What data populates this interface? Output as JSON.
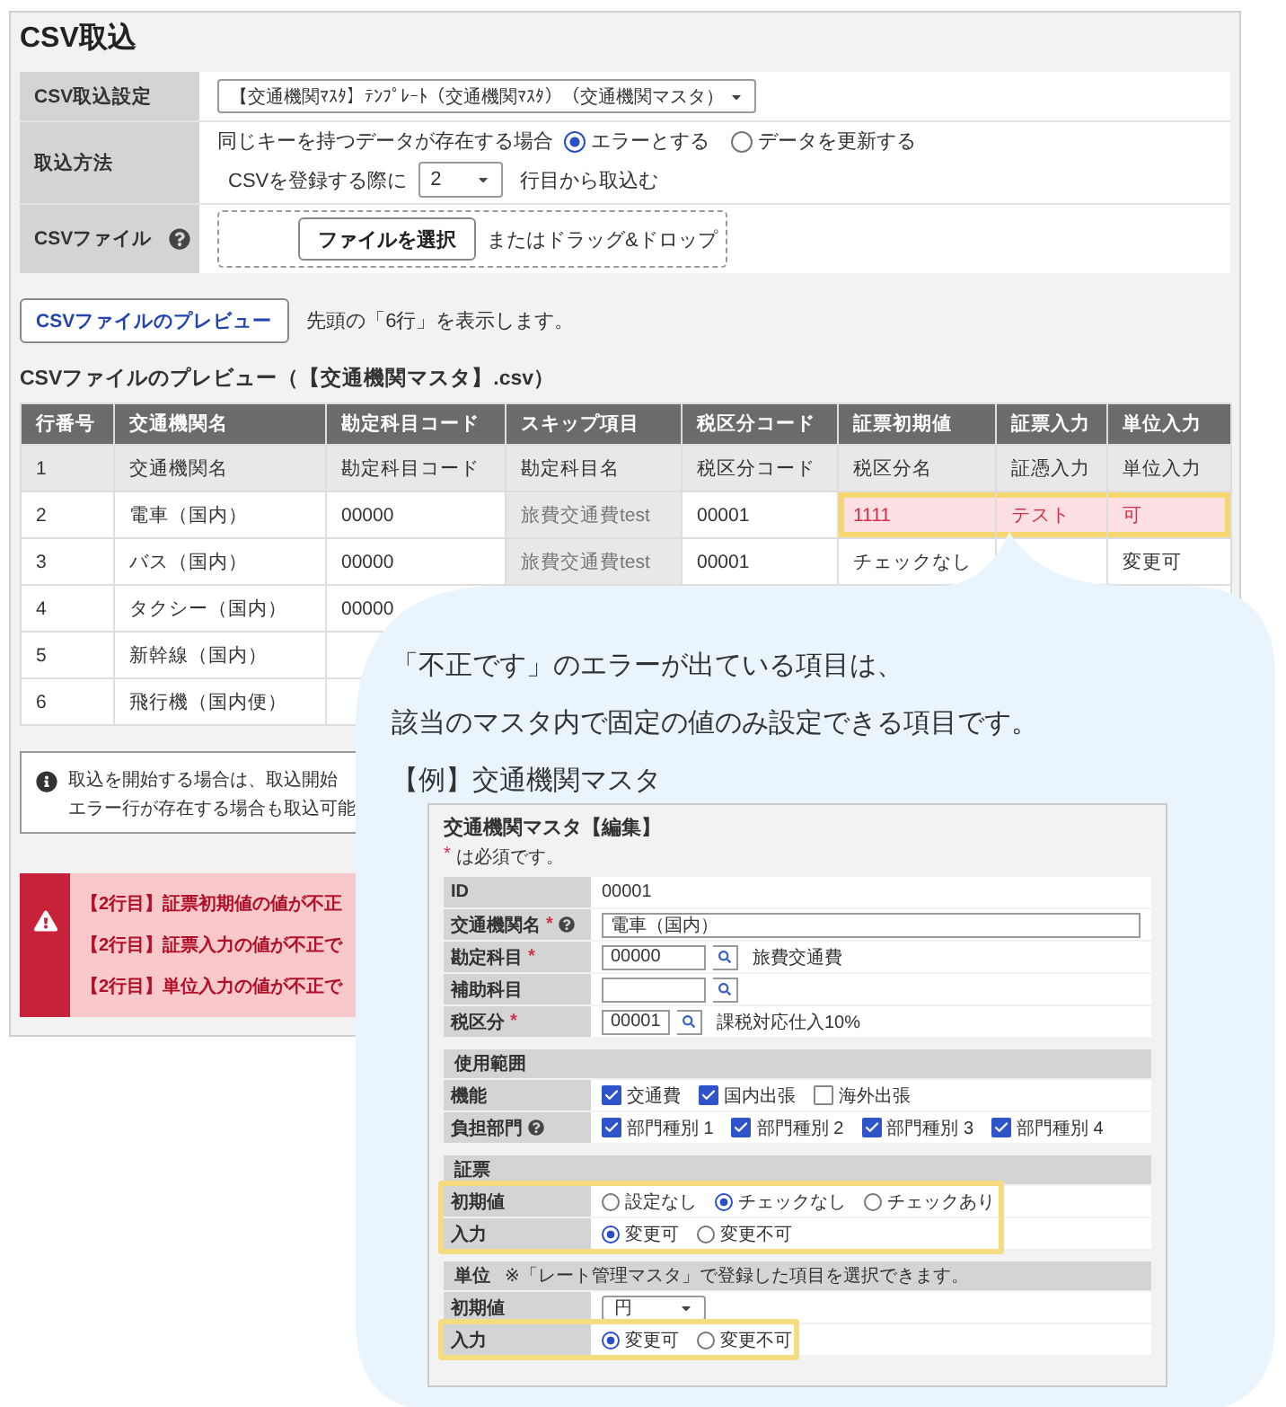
{
  "page_title": "CSV取込",
  "settings": [
    {
      "kind": "select",
      "label": "CSV取込設定",
      "help": false,
      "value": "【交通機関ﾏｽﾀ】ﾃﾝﾌﾟﾚｰﾄ（交通機関ﾏｽﾀ）（交通機関マスタ）"
    },
    {
      "kind": "method",
      "label": "取込方法",
      "help": false,
      "prompt": "同じキーを持つデータが存在する場合",
      "options": [
        {
          "label": "エラーとする",
          "selected": true
        },
        {
          "label": "データを更新する",
          "selected": false
        }
      ],
      "start_prefix": "CSVを登録する際に",
      "start_row": "2",
      "start_suffix": "行目から取込む"
    },
    {
      "kind": "file",
      "label": "CSVファイル",
      "help": true,
      "button": "ファイルを選択",
      "drop_hint": "またはドラッグ&ドロップ"
    }
  ],
  "preview_button": "CSVファイルのプレビュー",
  "preview_note": "先頭の「6行」を表示します。",
  "table": {
    "title": "CSVファイルのプレビュー（【交通機関マスタ】.csv）",
    "columns": [
      {
        "label": "行番号",
        "kind": "field"
      },
      {
        "label": "交通機関名",
        "kind": "field"
      },
      {
        "label": "勘定科目コード",
        "kind": "field"
      },
      {
        "label": "スキップ項目",
        "kind": "skip"
      },
      {
        "label": "税区分コード",
        "kind": "field"
      },
      {
        "label": "証票初期値",
        "kind": "field"
      },
      {
        "label": "証票入力",
        "kind": "field"
      },
      {
        "label": "単位入力",
        "kind": "field"
      }
    ],
    "rows": [
      {
        "kind": "csv_header",
        "cells": [
          {
            "text": "1",
            "error": false
          },
          {
            "text": "交通機関名",
            "error": false
          },
          {
            "text": "勘定科目コード",
            "error": false
          },
          {
            "text": "勘定科目名",
            "error": false
          },
          {
            "text": "税区分コード",
            "error": false
          },
          {
            "text": "税区分名",
            "error": false
          },
          {
            "text": "証憑入力",
            "error": false
          },
          {
            "text": "単位入力",
            "error": false
          }
        ]
      },
      {
        "kind": "data",
        "cells": [
          {
            "text": "2",
            "error": false
          },
          {
            "text": "電車（国内）",
            "error": false
          },
          {
            "text": "00000",
            "error": false
          },
          {
            "text": "旅費交通費test",
            "error": false
          },
          {
            "text": "00001",
            "error": false
          },
          {
            "text": "1111",
            "error": true
          },
          {
            "text": "テスト",
            "error": true
          },
          {
            "text": "可",
            "error": true
          }
        ]
      },
      {
        "kind": "data",
        "cells": [
          {
            "text": "3",
            "error": false
          },
          {
            "text": "バス（国内）",
            "error": false
          },
          {
            "text": "00000",
            "error": false
          },
          {
            "text": "旅費交通費test",
            "error": false
          },
          {
            "text": "00001",
            "error": false
          },
          {
            "text": "チェックなし",
            "error": false
          },
          null,
          {
            "text": "変更可",
            "error": false
          }
        ]
      },
      {
        "kind": "data",
        "cells": [
          {
            "text": "4",
            "error": false
          },
          {
            "text": "タクシー（国内）",
            "error": false
          },
          {
            "text": "00000",
            "error": false
          }
        ]
      },
      {
        "kind": "data",
        "cells": [
          {
            "text": "5",
            "error": false
          },
          {
            "text": "新幹線（国内）",
            "error": false
          }
        ]
      },
      {
        "kind": "data",
        "cells": [
          {
            "text": "6",
            "error": false
          },
          {
            "text": "飛行機（国内便）",
            "error": false
          }
        ]
      }
    ]
  },
  "info": {
    "lines": [
      "取込を開始する場合は、取込開始",
      "エラー行が存在する場合も取込可能"
    ]
  },
  "errors": [
    "【2行目】証票初期値の値が不正",
    "【2行目】証票入力の値が不正で",
    "【2行目】単位入力の値が不正で"
  ],
  "callout": {
    "lines": [
      "「不正です」のエラーが出ている項目は、",
      "該当のマスタ内で固定の値のみ設定できる項目です。"
    ],
    "example_label": "【例】交通機関マスタ",
    "form": {
      "title": "交通機関マスタ【編集】",
      "required_mark": "*",
      "required_note": "は必須です。",
      "sections": [
        {
          "rows": [
            {
              "kind": "text",
              "label": "ID",
              "required": false,
              "help": false,
              "highlighted": false,
              "value": "00001"
            },
            {
              "kind": "input",
              "label": "交通機関名",
              "required": true,
              "help": true,
              "highlighted": false,
              "value": "電車（国内）"
            },
            {
              "kind": "lookup",
              "label": "勘定科目",
              "required": true,
              "help": false,
              "highlighted": false,
              "value": "00000",
              "note": "旅費交通費"
            },
            {
              "kind": "lookup",
              "label": "補助科目",
              "required": false,
              "help": false,
              "highlighted": false
            },
            {
              "kind": "lookup",
              "label": "税区分",
              "required": true,
              "help": false,
              "highlighted": false,
              "value": "00001",
              "note": "課税対応仕入10%"
            }
          ]
        },
        {
          "title": "使用範囲",
          "rows": [
            {
              "kind": "checks",
              "label": "機能",
              "required": false,
              "help": false,
              "highlighted": false,
              "options": [
                {
                  "label": "交通費",
                  "checked": true
                },
                {
                  "label": "国内出張",
                  "checked": true
                },
                {
                  "label": "海外出張",
                  "checked": false
                }
              ]
            },
            {
              "kind": "checks",
              "label": "負担部門",
              "required": false,
              "help": true,
              "highlighted": false,
              "options": [
                {
                  "label": "部門種別 1",
                  "checked": true
                },
                {
                  "label": "部門種別 2",
                  "checked": true
                },
                {
                  "label": "部門種別 3",
                  "checked": true
                },
                {
                  "label": "部門種別 4",
                  "checked": true
                }
              ]
            }
          ]
        },
        {
          "title": "証票",
          "rows": [
            {
              "kind": "radios",
              "label": "初期値",
              "required": false,
              "help": false,
              "highlighted": true,
              "options": [
                {
                  "label": "設定なし",
                  "selected": false
                },
                {
                  "label": "チェックなし",
                  "selected": true
                },
                {
                  "label": "チェックあり",
                  "selected": false
                }
              ]
            },
            {
              "kind": "radios",
              "label": "入力",
              "required": false,
              "help": false,
              "highlighted": true,
              "options": [
                {
                  "label": "変更可",
                  "selected": true
                },
                {
                  "label": "変更不可",
                  "selected": false
                }
              ]
            }
          ]
        },
        {
          "title": "単位",
          "note": "※「レート管理マスタ」で登録した項目を選択できます。",
          "rows": [
            {
              "kind": "select",
              "label": "初期値",
              "required": false,
              "help": false,
              "highlighted": false,
              "value": "円"
            },
            {
              "kind": "radios",
              "label": "入力",
              "required": false,
              "help": false,
              "highlighted": true,
              "options": [
                {
                  "label": "変更可",
                  "selected": true
                },
                {
                  "label": "変更不可",
                  "selected": false
                }
              ]
            }
          ]
        }
      ]
    }
  }
}
